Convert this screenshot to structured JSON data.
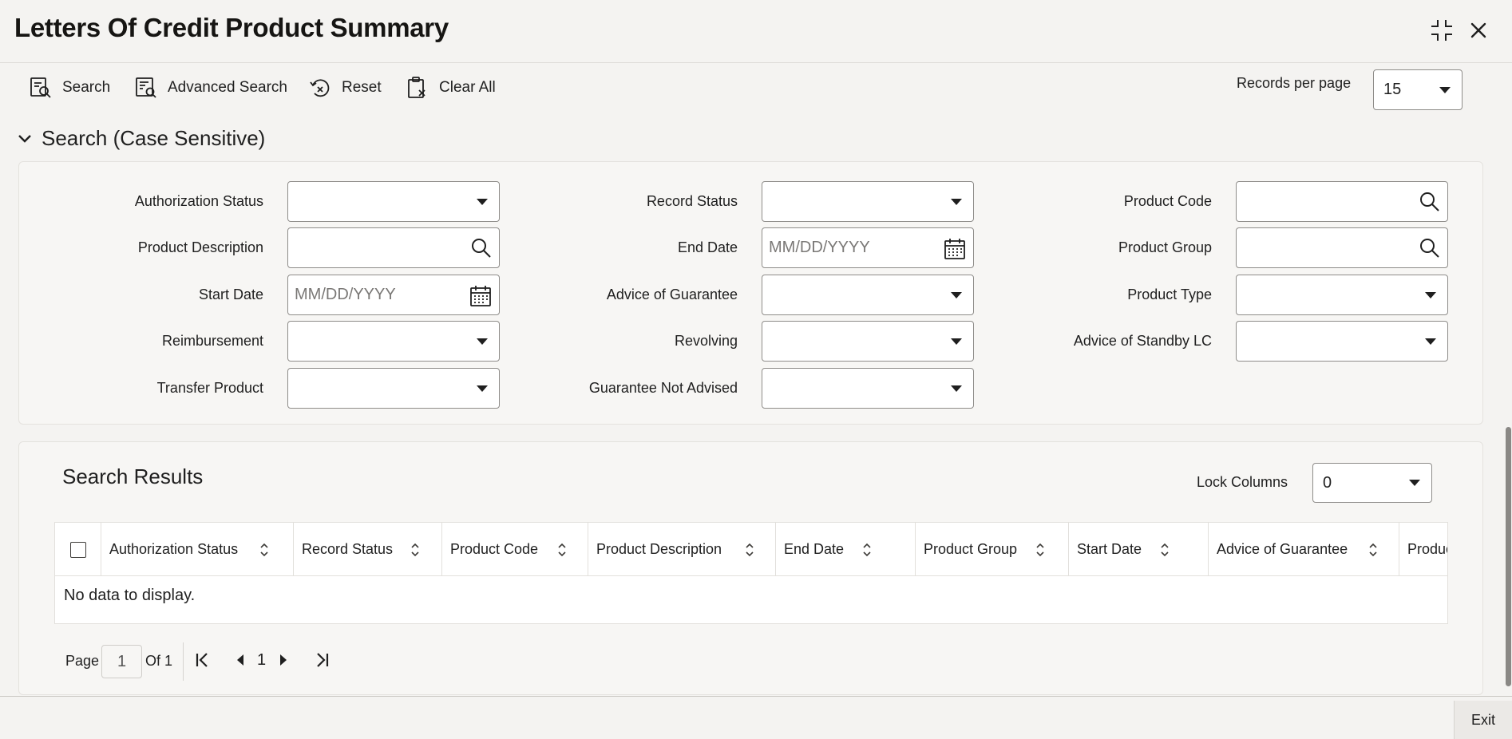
{
  "header": {
    "title": "Letters Of Credit Product Summary"
  },
  "toolbar": {
    "search": "Search",
    "advanced_search": "Advanced Search",
    "reset": "Reset",
    "clear_all": "Clear All",
    "records_per_page_label": "Records per page",
    "records_per_page_value": "15"
  },
  "search_section": {
    "title": "Search (Case Sensitive)",
    "fields": {
      "authorization_status": {
        "label": "Authorization Status",
        "value": ""
      },
      "record_status": {
        "label": "Record Status",
        "value": ""
      },
      "product_code": {
        "label": "Product Code",
        "value": ""
      },
      "product_description": {
        "label": "Product Description",
        "value": ""
      },
      "end_date": {
        "label": "End Date",
        "placeholder": "MM/DD/YYYY"
      },
      "product_group": {
        "label": "Product Group",
        "value": ""
      },
      "start_date": {
        "label": "Start Date",
        "placeholder": "MM/DD/YYYY"
      },
      "advice_of_guarantee": {
        "label": "Advice of Guarantee",
        "value": ""
      },
      "product_type": {
        "label": "Product Type",
        "value": ""
      },
      "reimbursement": {
        "label": "Reimbursement",
        "value": ""
      },
      "revolving": {
        "label": "Revolving",
        "value": ""
      },
      "advice_of_standby_lc": {
        "label": "Advice of Standby LC",
        "value": ""
      },
      "transfer_product": {
        "label": "Transfer Product",
        "value": ""
      },
      "guarantee_not_advised": {
        "label": "Guarantee Not Advised",
        "value": ""
      }
    }
  },
  "results": {
    "title": "Search Results",
    "lock_columns_label": "Lock Columns",
    "lock_columns_value": "0",
    "columns": [
      "Authorization Status",
      "Record Status",
      "Product Code",
      "Product Description",
      "End Date",
      "Product Group",
      "Start Date",
      "Advice of Guarantee",
      "Produc"
    ],
    "empty_message": "No data to display."
  },
  "pagination": {
    "page_label": "Page",
    "current_page": "1",
    "of_label": "Of 1",
    "page_number": "1"
  },
  "footer": {
    "exit": "Exit"
  }
}
